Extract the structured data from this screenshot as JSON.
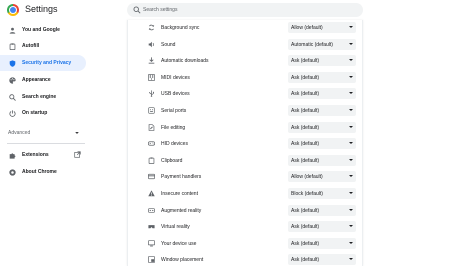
{
  "header": {
    "title": "Settings",
    "search_placeholder": "Search settings"
  },
  "sidebar": {
    "items": [
      {
        "label": "You and Google",
        "icon": "person-icon"
      },
      {
        "label": "Autofill",
        "icon": "clipboard-icon"
      },
      {
        "label": "Security and Privacy",
        "icon": "shield-icon",
        "active": true
      },
      {
        "label": "Appearance",
        "icon": "palette-icon"
      },
      {
        "label": "Search engine",
        "icon": "search-icon"
      },
      {
        "label": "On startup",
        "icon": "power-icon"
      }
    ],
    "advanced_label": "Advanced",
    "extensions_label": "Extensions",
    "about_label": "About Chrome"
  },
  "permissions": [
    {
      "label": "Background sync",
      "value": "Allow (default)",
      "icon": "sync-icon"
    },
    {
      "label": "Sound",
      "value": "Automatic (default)",
      "icon": "speaker-icon"
    },
    {
      "label": "Automatic downloads",
      "value": "Ask (default)",
      "icon": "download-icon"
    },
    {
      "label": "MIDI devices",
      "value": "Ask (default)",
      "icon": "piano-icon"
    },
    {
      "label": "USB devices",
      "value": "Ask (default)",
      "icon": "usb-icon"
    },
    {
      "label": "Serial ports",
      "value": "Ask (default)",
      "icon": "serial-port-icon"
    },
    {
      "label": "File editing",
      "value": "Ask (default)",
      "icon": "file-edit-icon"
    },
    {
      "label": "HID devices",
      "value": "Ask (default)",
      "icon": "gamepad-icon"
    },
    {
      "label": "Clipboard",
      "value": "Ask (default)",
      "icon": "clipboard-icon"
    },
    {
      "label": "Payment handlers",
      "value": "Allow (default)",
      "icon": "credit-card-icon"
    },
    {
      "label": "Insecure content",
      "value": "Block (default)",
      "icon": "warning-icon"
    },
    {
      "label": "Augmented reality",
      "value": "Ask (default)",
      "icon": "ar-icon"
    },
    {
      "label": "Virtual reality",
      "value": "Ask (default)",
      "icon": "vr-headset-icon"
    },
    {
      "label": "Your device use",
      "value": "Ask (default)",
      "icon": "device-use-icon"
    },
    {
      "label": "Window placement",
      "value": "Ask (default)",
      "icon": "window-icon"
    }
  ],
  "colors": {
    "accent": "#1a73e8",
    "active_bg": "#e8f0fe",
    "select_bg": "#f1f3f4",
    "icon": "#5f6368"
  }
}
